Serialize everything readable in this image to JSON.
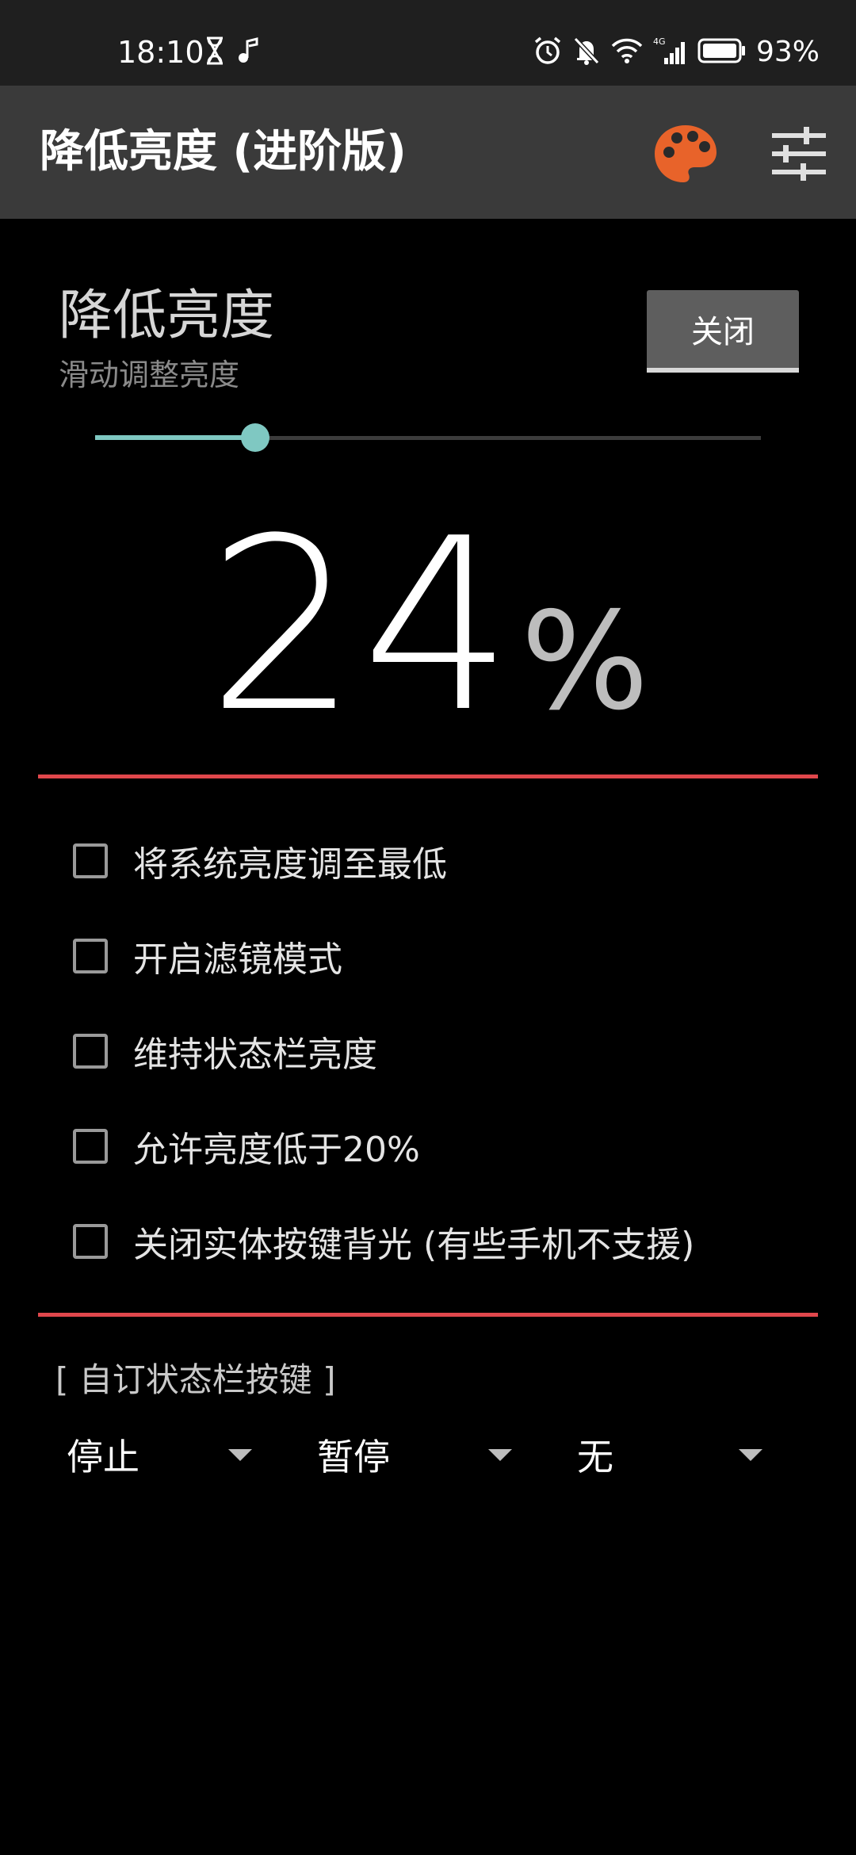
{
  "status_bar": {
    "time": "18:10",
    "battery_percent": "93%",
    "left_icons": [
      "hourglass-icon",
      "music-note-icon"
    ],
    "right_icons": [
      "alarm-icon",
      "mute-bell-icon",
      "wifi-icon",
      "signal-4g-icon",
      "battery-icon"
    ],
    "network_label": "4G"
  },
  "app_bar": {
    "title": "降低亮度 (进阶版)",
    "actions": [
      "palette-icon",
      "tune-settings-icon"
    ],
    "palette_color": "#e8632a"
  },
  "brightness": {
    "title": "降低亮度",
    "subtitle": "滑动调整亮度",
    "toggle_label": "关闭",
    "slider_level": 0.24,
    "percent_value": "24",
    "percent_sign": "%",
    "accent_color": "#7fc8c2",
    "divider_color": "#e0474c"
  },
  "options": [
    {
      "label": "将系统亮度调至最低",
      "checked": false
    },
    {
      "label": "开启滤镜模式",
      "checked": false
    },
    {
      "label": "维持状态栏亮度",
      "checked": false
    },
    {
      "label": "允许亮度低于20%",
      "checked": false
    },
    {
      "label": "关闭实体按键背光 (有些手机不支援)",
      "checked": false
    }
  ],
  "custom_keys": {
    "label": "[ 自订状态栏按键 ]",
    "spinners": [
      {
        "value": "停止"
      },
      {
        "value": "暂停"
      },
      {
        "value": "无"
      }
    ]
  }
}
